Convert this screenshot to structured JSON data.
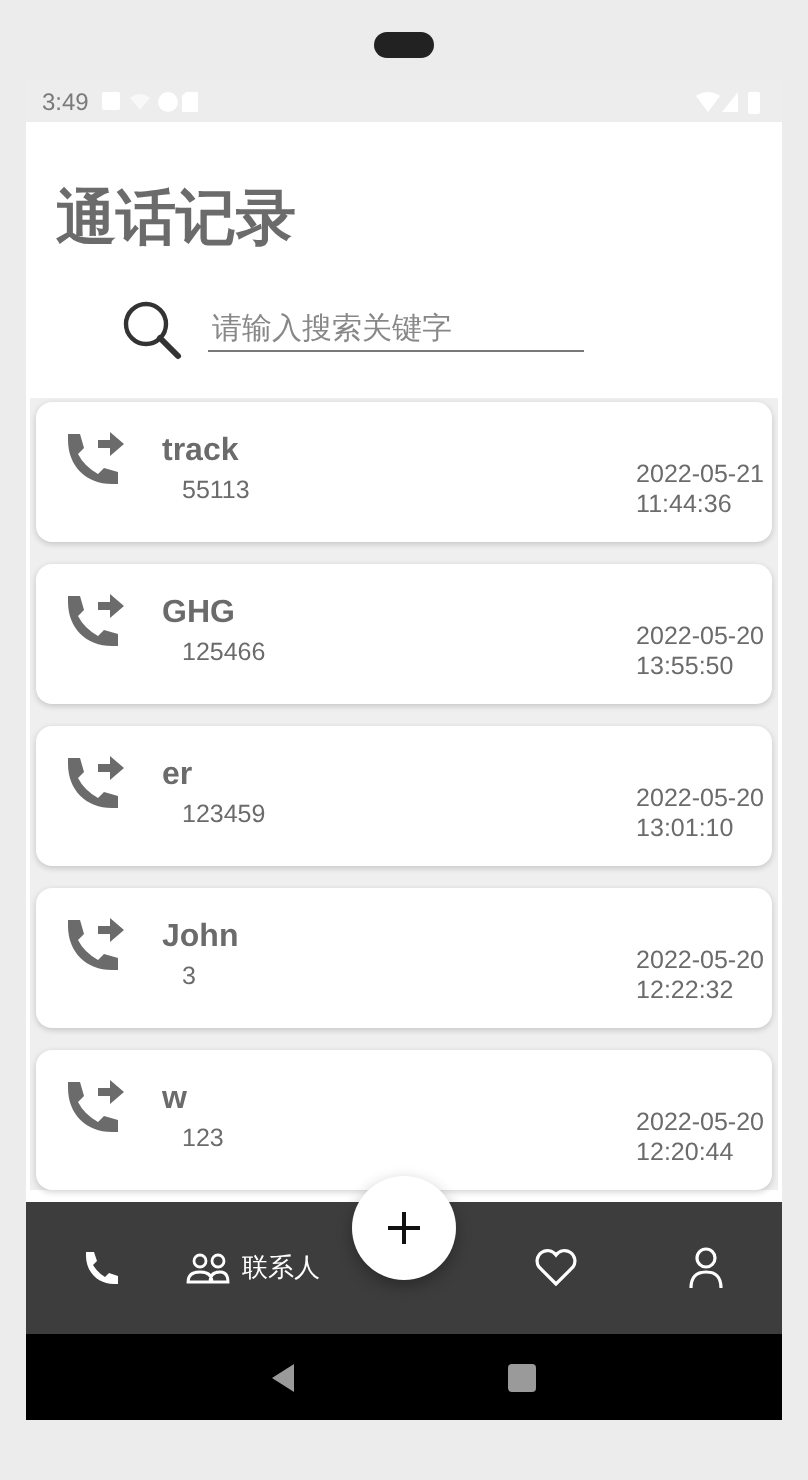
{
  "status_bar": {
    "time": "3:49"
  },
  "title": "通话记录",
  "search": {
    "placeholder": "请输入搜索关键字"
  },
  "calls": [
    {
      "name": "track",
      "number": "55113",
      "date": "2022-05-21",
      "time": "11:44:36"
    },
    {
      "name": "GHG",
      "number": "125466",
      "date": "2022-05-20",
      "time": "13:55:50"
    },
    {
      "name": "er",
      "number": "123459",
      "date": "2022-05-20",
      "time": "13:01:10"
    },
    {
      "name": "John",
      "number": "3",
      "date": "2022-05-20",
      "time": "12:22:32"
    },
    {
      "name": "w",
      "number": "123",
      "date": "2022-05-20",
      "time": "12:20:44"
    }
  ],
  "bottom_nav": [
    {
      "kind": "phone"
    },
    {
      "kind": "contacts",
      "label": "联系人"
    },
    {
      "kind": "add"
    },
    {
      "kind": "heart"
    },
    {
      "kind": "person"
    }
  ]
}
